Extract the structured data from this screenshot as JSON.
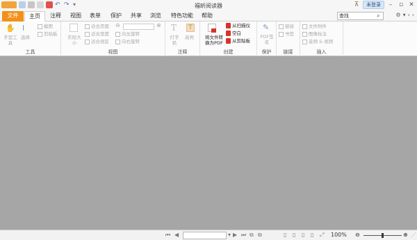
{
  "app": {
    "title": "福昕阅读器"
  },
  "titlebar": {
    "badge": "未登录"
  },
  "window_controls": {
    "min": "–",
    "restore": "▫",
    "close": "✕"
  },
  "tabs": {
    "file": "文件",
    "home": "主页",
    "comment": "注释",
    "view": "视图",
    "form": "表单",
    "protect": "保护",
    "share": "共享",
    "browse": "浏览",
    "features": "特色功能",
    "help": "帮助"
  },
  "search": {
    "value": "查找"
  },
  "ribbon": {
    "tools": {
      "label": "工具",
      "hand": "手型工具",
      "select": "选择",
      "snapshot": "截图",
      "clipboard": "剪贴板"
    },
    "view": {
      "label": "视图",
      "actual_size": "实际大小",
      "fit_page": "适合页面",
      "fit_width": "适合宽度",
      "fit_visible": "适合视区",
      "rotate_left": "向左旋转",
      "rotate_right": "向右旋转"
    },
    "comment": {
      "label": "注释",
      "typewriter": "打字机",
      "highlight": "高亮"
    },
    "create": {
      "label": "创建",
      "convert": "将文件转换为PDF",
      "from_scanner": "从扫描仪",
      "blank": "空白",
      "from_clipboard": "从剪贴板"
    },
    "protect": {
      "label": "保护",
      "pdf_sign": "PDF签名"
    },
    "link": {
      "label": "链接",
      "link": "链接",
      "bookmark": "书签"
    },
    "insert": {
      "label": "插入",
      "attachment": "文件附件",
      "image_annot": "图像标注",
      "audio_video": "音频 & 视频"
    }
  },
  "status": {
    "zoom": "100%"
  },
  "colors": {
    "accent": "#f39019",
    "canvas": "#a6a6a6",
    "red_icon": "#d9322b"
  }
}
